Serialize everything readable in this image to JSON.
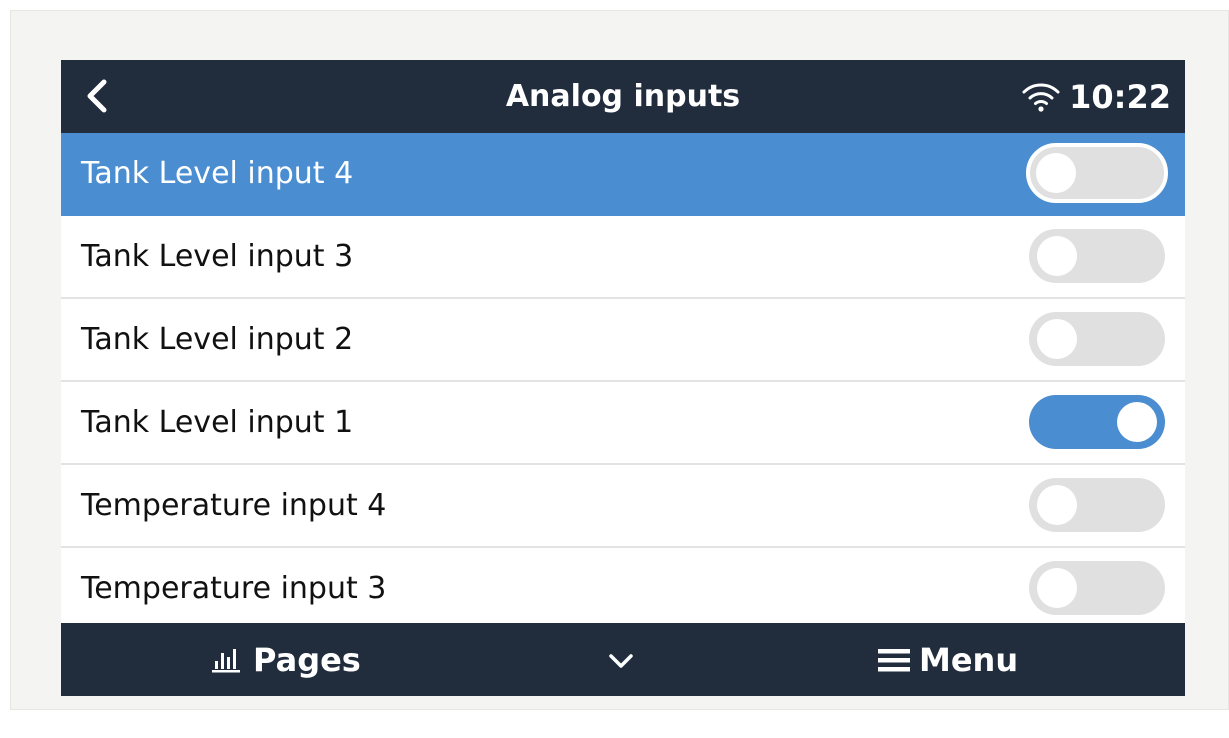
{
  "header": {
    "title": "Analog inputs",
    "time": "10:22",
    "back_icon": "chevron-left-icon",
    "wifi_icon": "wifi-icon"
  },
  "inputs": [
    {
      "label": "Tank Level input 4",
      "enabled": false,
      "selected": true
    },
    {
      "label": "Tank Level input 3",
      "enabled": false,
      "selected": false
    },
    {
      "label": "Tank Level input 2",
      "enabled": false,
      "selected": false
    },
    {
      "label": "Tank Level input 1",
      "enabled": true,
      "selected": false
    },
    {
      "label": "Temperature input 4",
      "enabled": false,
      "selected": false
    },
    {
      "label": "Temperature input 3",
      "enabled": false,
      "selected": false
    }
  ],
  "footer": {
    "pages_label": "Pages",
    "menu_label": "Menu",
    "pages_icon": "bar-chart-icon",
    "down_icon": "chevron-down-icon",
    "menu_icon": "hamburger-menu-icon"
  },
  "colors": {
    "bar": "#212d3d",
    "accent": "#4a8dd0",
    "toggle_off": "#e0e0e0",
    "frame": "#f4f4f2"
  }
}
